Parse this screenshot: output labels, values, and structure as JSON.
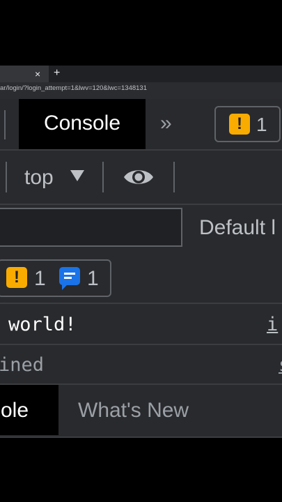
{
  "browser": {
    "tab_close": "×",
    "new_tab": "+",
    "url": "ar/login/?login_attempt=1&lwv=120&lwc=1348131"
  },
  "devtools": {
    "tabs": {
      "console": "Console",
      "more": "»"
    },
    "issues": {
      "icon": "warning-icon",
      "count": "1"
    },
    "context": {
      "label": "top"
    },
    "filter": {
      "placeholder": ""
    },
    "levels": {
      "label": "Default l"
    },
    "counts": {
      "warnings": "1",
      "info": "1"
    },
    "messages": [
      {
        "text": "world!",
        "link": "i"
      },
      {
        "text": "ined",
        "link": "s"
      }
    ],
    "drawer": {
      "tabs": [
        "sole",
        "What's New"
      ]
    }
  },
  "colors": {
    "warning": "#f9ab00",
    "info": "#1a73e8",
    "panel_bg": "#292a2d"
  }
}
